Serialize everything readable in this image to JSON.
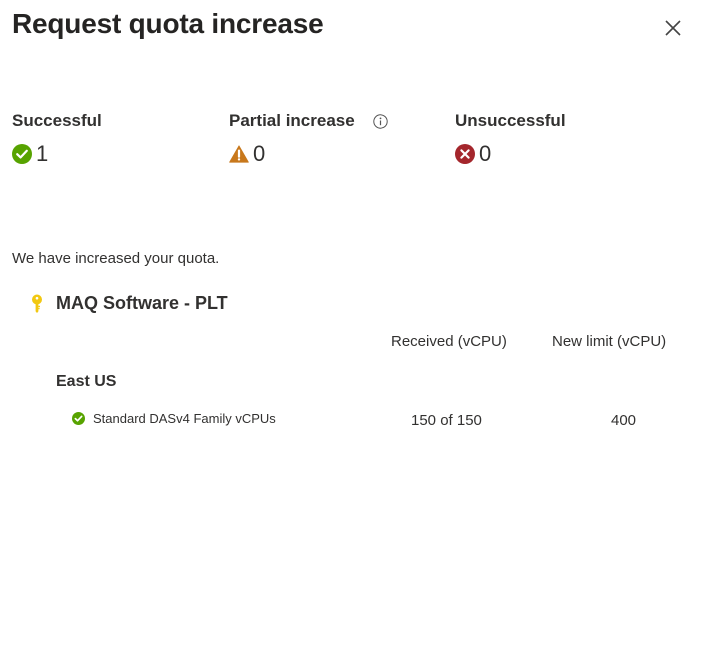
{
  "dialog": {
    "title": "Request quota increase",
    "close_icon": "close-icon"
  },
  "summary": {
    "successful": {
      "label": "Successful",
      "count": "1",
      "icon": "check-circle-icon",
      "color": "#57a300"
    },
    "partial": {
      "label": "Partial increase",
      "count": "0",
      "icon": "warning-icon",
      "info_icon": "info-icon",
      "color": "#c8781c"
    },
    "unsuccessful": {
      "label": "Unsuccessful",
      "count": "0",
      "icon": "error-circle-icon",
      "color": "#a4262c"
    }
  },
  "message": "We have increased your quota.",
  "subscription": {
    "name": "MAQ Software - PLT",
    "icon": "key-icon",
    "color": "#f2c811"
  },
  "columns": {
    "received": "Received (vCPU)",
    "new_limit": "New limit (vCPU)"
  },
  "regions": [
    {
      "name": "East US",
      "quotas": [
        {
          "name": "Standard DASv4 Family vCPUs",
          "status_icon": "check-circle-icon",
          "received": "150 of 150",
          "new_limit": "400"
        }
      ]
    }
  ]
}
